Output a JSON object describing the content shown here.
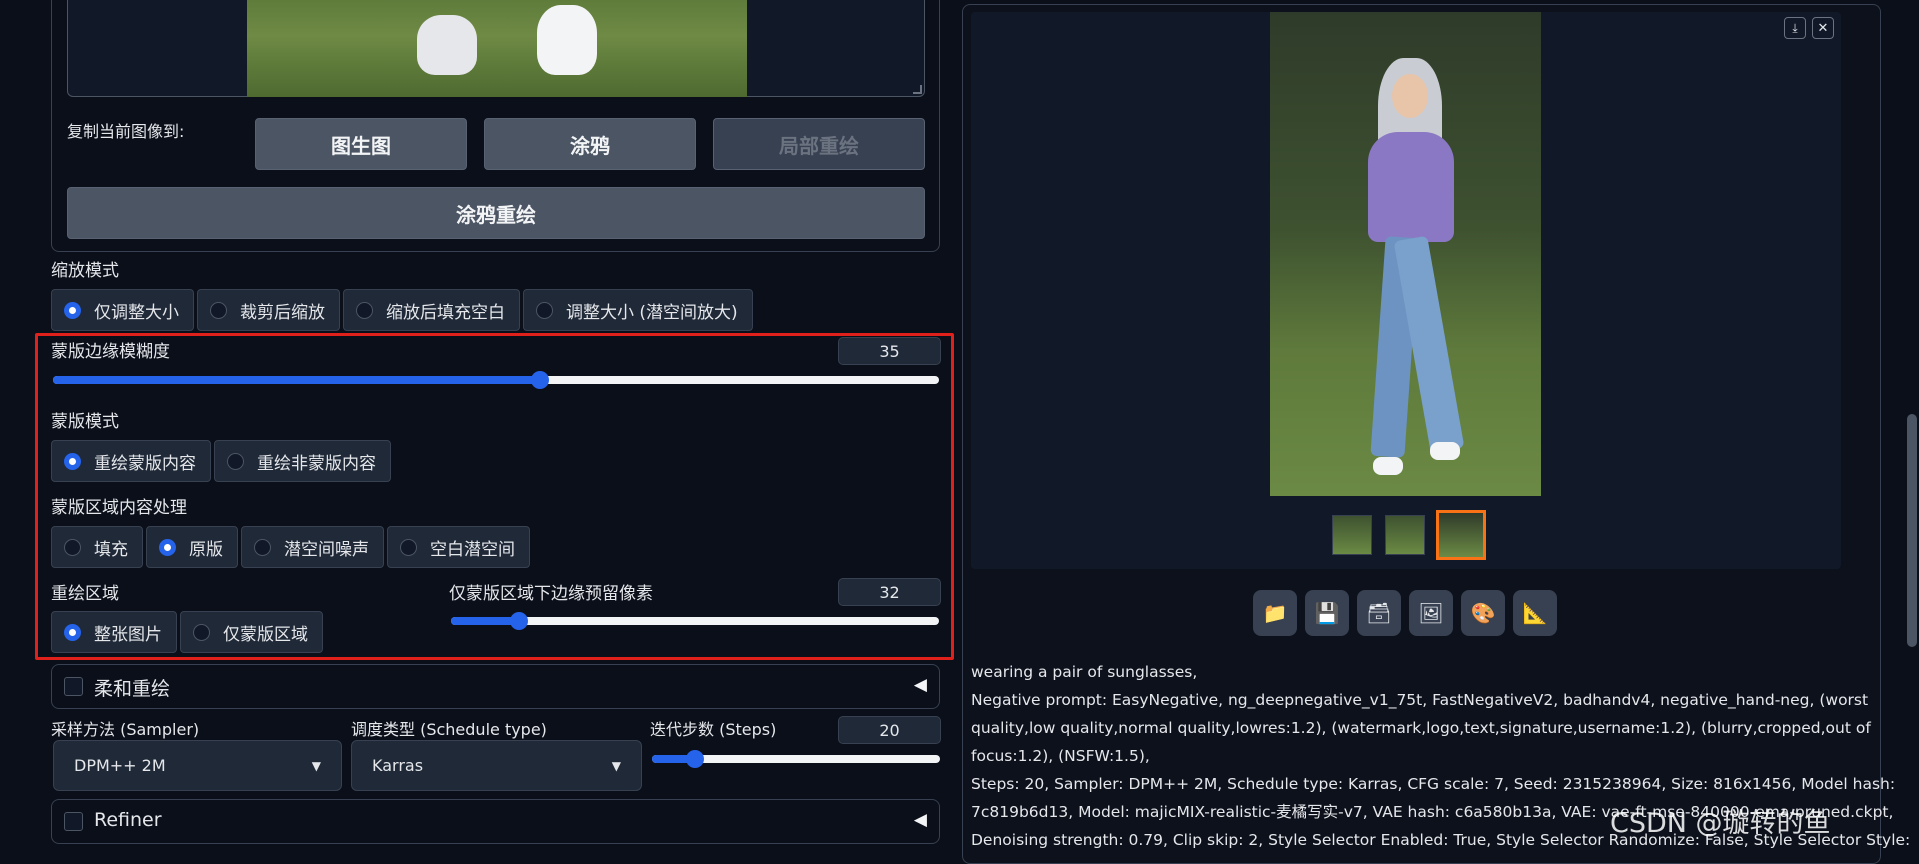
{
  "left": {
    "copy_label": "复制当前图像到:",
    "copy_buttons": [
      "图生图",
      "涂鸦",
      "局部重绘"
    ],
    "sketch_inpaint_button": "涂鸦重绘",
    "resize_mode": {
      "label": "缩放模式",
      "options": [
        "仅调整大小",
        "裁剪后缩放",
        "缩放后填充空白",
        "调整大小 (潜空间放大)"
      ],
      "selected": "仅调整大小"
    },
    "mask_blur": {
      "label": "蒙版边缘模糊度",
      "value": "35",
      "fraction": 0.55
    },
    "mask_mode": {
      "label": "蒙版模式",
      "options": [
        "重绘蒙版内容",
        "重绘非蒙版内容"
      ],
      "selected": "重绘蒙版内容"
    },
    "masked_content": {
      "label": "蒙版区域内容处理",
      "options": [
        "填充",
        "原版",
        "潜空间噪声",
        "空白潜空间"
      ],
      "selected": "原版"
    },
    "inpaint_area": {
      "label": "重绘区域",
      "options": [
        "整张图片",
        "仅蒙版区域"
      ],
      "selected": "整张图片"
    },
    "only_masked_padding": {
      "label": "仅蒙版区域下边缘预留像素",
      "value": "32",
      "fraction": 0.14
    },
    "soft_inpainting": {
      "label": "柔和重绘",
      "arrow": "◀"
    },
    "sampler": {
      "label": "采样方法 (Sampler)",
      "value": "DPM++ 2M"
    },
    "schedule": {
      "label": "调度类型 (Schedule type)",
      "value": "Karras"
    },
    "steps": {
      "label": "迭代步数 (Steps)",
      "value": "20",
      "fraction": 0.15
    },
    "refiner": {
      "label": "Refiner",
      "arrow": "◀"
    }
  },
  "right": {
    "tools": [
      {
        "icon": "folder-icon",
        "glyph": "📁"
      },
      {
        "icon": "save-icon",
        "glyph": "💾"
      },
      {
        "icon": "zip-icon",
        "glyph": "🗃"
      },
      {
        "icon": "image-icon",
        "glyph": "🖼"
      },
      {
        "icon": "palette-icon",
        "glyph": "🎨"
      },
      {
        "icon": "ruler-icon",
        "glyph": "📐"
      }
    ],
    "info_lines": [
      "wearing a pair of sunglasses,",
      "Negative prompt: EasyNegative, ng_deepnegative_v1_75t, FastNegativeV2, badhandv4, negative_hand-neg, (worst",
      "quality,low quality,normal quality,lowres:1.2), (watermark,logo,text,signature,username:1.2), (blurry,cropped,out of",
      "focus:1.2), (NSFW:1.5),",
      "Steps: 20, Sampler: DPM++ 2M, Schedule type: Karras, CFG scale: 7, Seed: 2315238964, Size: 816x1456, Model hash:",
      "7c819b6d13, Model: majicMIX-realistic-麦橘写实-v7, VAE hash: c6a580b13a, VAE: vae-ft-mse-840000-ema-pruned.ckpt,",
      "Denoising strength: 0.79, Clip skip: 2, Style Selector Enabled: True, Style Selector Randomize: False, Style Selector Style:"
    ],
    "watermark": "CSDN @璇转的鱼"
  },
  "colors": {
    "accent": "#2563eb",
    "highlight_border": "#e0211b",
    "thumb_selected": "#f97316"
  }
}
